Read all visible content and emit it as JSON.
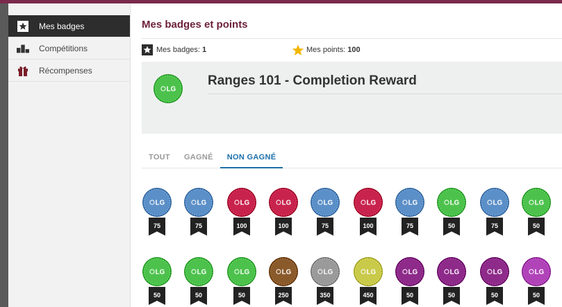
{
  "sidebar": {
    "items": [
      {
        "label": "Mes badges",
        "icon": "star-icon",
        "active": true
      },
      {
        "label": "Compétitions",
        "icon": "podium-icon",
        "active": false
      },
      {
        "label": "Récompenses",
        "icon": "gift-icon",
        "active": false
      }
    ]
  },
  "main": {
    "title": "Mes badges et points",
    "badges_label": "Mes badges:",
    "badges_count": "1",
    "points_label": "Mes points:",
    "points_count": "100"
  },
  "featured": {
    "title": "Ranges 101 - Completion Reward",
    "badge_text": "LG",
    "badge_color": "#4cc24c"
  },
  "tabs": [
    {
      "label": "TOUT",
      "active": false
    },
    {
      "label": "GAGNÉ",
      "active": false
    },
    {
      "label": "NON GAGNÉ",
      "active": true
    }
  ],
  "badges": [
    {
      "text": "LG",
      "points": "75",
      "color": "#5b8fc7"
    },
    {
      "text": "LG",
      "points": "75",
      "color": "#5b8fc7"
    },
    {
      "text": "LG",
      "points": "100",
      "color": "#c8234d"
    },
    {
      "text": "LG",
      "points": "100",
      "color": "#c8234d"
    },
    {
      "text": "LG",
      "points": "75",
      "color": "#5b8fc7"
    },
    {
      "text": "LG",
      "points": "100",
      "color": "#c8234d"
    },
    {
      "text": "LG",
      "points": "75",
      "color": "#5b8fc7"
    },
    {
      "text": "LG",
      "points": "50",
      "color": "#4cc24c"
    },
    {
      "text": "LG",
      "points": "75",
      "color": "#5b8fc7"
    },
    {
      "text": "LG",
      "points": "50",
      "color": "#4cc24c"
    },
    {
      "text": "LG",
      "points": "50",
      "color": "#4cc24c"
    },
    {
      "text": "LG",
      "points": "50",
      "color": "#4cc24c"
    },
    {
      "text": "LG",
      "points": "50",
      "color": "#4cc24c"
    },
    {
      "text": "LG",
      "points": "250",
      "color": "#8a5a2b"
    },
    {
      "text": "LG",
      "points": "350",
      "color": "#9a9a9a"
    },
    {
      "text": "LG",
      "points": "450",
      "color": "#c9c94a"
    },
    {
      "text": "LG",
      "points": "50",
      "color": "#8e2a8a"
    },
    {
      "text": "LG",
      "points": "50",
      "color": "#8e2a8a"
    },
    {
      "text": "LG",
      "points": "50",
      "color": "#8e2a8a"
    },
    {
      "text": "LG",
      "points": "50",
      "color": "#b043b8"
    }
  ]
}
